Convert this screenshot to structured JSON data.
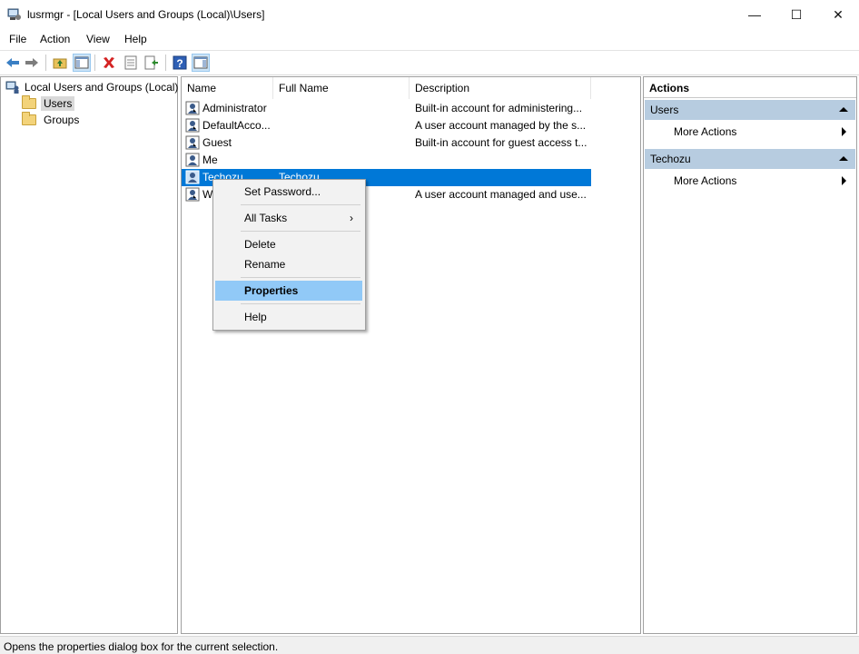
{
  "window": {
    "title": "lusrmgr - [Local Users and Groups (Local)\\Users]",
    "minimize": "—",
    "maximize": "☐",
    "close": "✕"
  },
  "menu": [
    "File",
    "Action",
    "View",
    "Help"
  ],
  "toolbar": {
    "icons": [
      "back-icon",
      "forward-icon",
      "up-folder-icon",
      "show-hide-tree-icon",
      "delete-icon",
      "properties-icon",
      "export-list-icon",
      "help-icon",
      "show-hide-action-pane-icon"
    ]
  },
  "tree": {
    "root": "Local Users and Groups (Local)",
    "children": [
      "Users",
      "Groups"
    ],
    "selected": "Users"
  },
  "list": {
    "columns": [
      "Name",
      "Full Name",
      "Description"
    ],
    "rows": [
      {
        "name": "Administrator",
        "full_name": "",
        "description": "Built-in account for administering..."
      },
      {
        "name": "DefaultAcco...",
        "full_name": "",
        "description": "A user account managed by the s..."
      },
      {
        "name": "Guest",
        "full_name": "",
        "description": "Built-in account for guest access t..."
      },
      {
        "name": "Me",
        "full_name": "",
        "description": ""
      },
      {
        "name": "Techozu",
        "full_name": "Techozu",
        "description": ""
      },
      {
        "name": "W",
        "full_name": "",
        "description": "A user account managed and use..."
      }
    ],
    "selected_index": 4
  },
  "context_menu": {
    "items": [
      "Set Password...",
      "All Tasks",
      "Delete",
      "Rename",
      "Properties",
      "Help"
    ],
    "submenu_arrow": "›",
    "highlighted": "Properties"
  },
  "actions": {
    "title": "Actions",
    "sections": [
      {
        "header": "Users",
        "items": [
          "More Actions"
        ]
      },
      {
        "header": "Techozu",
        "items": [
          "More Actions"
        ]
      }
    ]
  },
  "status": "Opens the properties dialog box for the current selection.",
  "colors": {
    "selection": "#0078d7",
    "menu_highlight": "#91c9f7",
    "actions_header": "#b7cce0"
  }
}
